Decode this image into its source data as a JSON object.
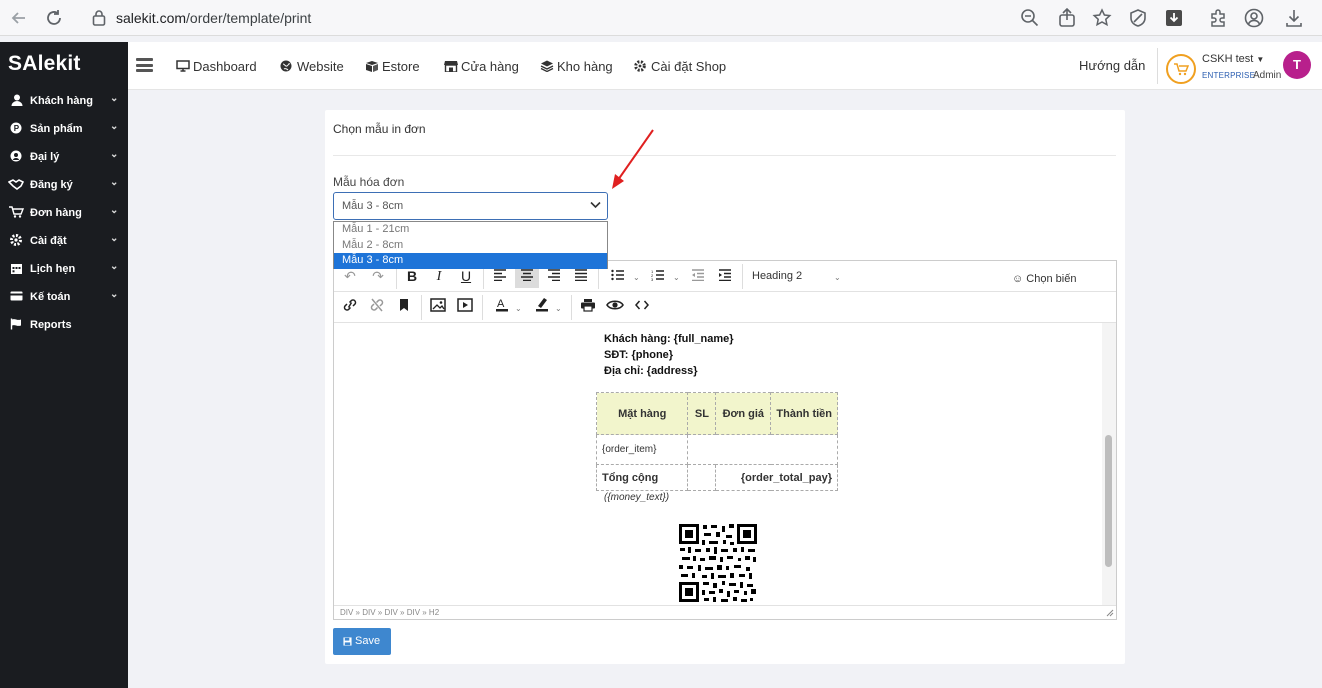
{
  "browser": {
    "url_host": "salekit.com",
    "url_path": "/order/template/print"
  },
  "app": {
    "logo": "SAlekit"
  },
  "sidebar": {
    "items": [
      {
        "label": "Khách hàng",
        "icon": "user-icon"
      },
      {
        "label": "Sản phẩm",
        "icon": "product-icon"
      },
      {
        "label": "Đại lý",
        "icon": "agent-icon"
      },
      {
        "label": "Đăng ký",
        "icon": "handshake-icon"
      },
      {
        "label": "Đơn hàng",
        "icon": "cart-icon"
      },
      {
        "label": "Cài đặt",
        "icon": "gear-icon"
      },
      {
        "label": "Lịch hẹn",
        "icon": "calendar-icon"
      },
      {
        "label": "Kế toán",
        "icon": "card-icon"
      },
      {
        "label": "Reports",
        "icon": "flag-icon"
      }
    ]
  },
  "topnav": {
    "items": [
      {
        "label": "Dashboard",
        "icon": "monitor-icon"
      },
      {
        "label": "Website",
        "icon": "globe-icon"
      },
      {
        "label": "Estore",
        "icon": "box-icon"
      },
      {
        "label": "Cửa hàng",
        "icon": "store-icon"
      },
      {
        "label": "Kho hàng",
        "icon": "layers-icon"
      },
      {
        "label": "Cài đặt Shop",
        "icon": "gear-icon"
      }
    ],
    "guide": "Hướng dẫn",
    "user_name": "CSKH test",
    "plan": "ENTERPRISE",
    "role": "Admin",
    "avatar_letter": "T"
  },
  "card": {
    "title": "Chọn mẫu in đơn",
    "field_label": "Mẫu hóa đơn",
    "selected": "Mẫu 3 - 8cm",
    "options": [
      "Mẫu 1 - 21cm",
      "Mẫu 2 - 8cm",
      "Mẫu 3 - 8cm"
    ]
  },
  "editor": {
    "heading_select": "Heading 2",
    "insert_variable": "Chọn biến",
    "status_path": "DIV » DIV » DIV » DIV » H2",
    "doc": {
      "customer": "Khách hàng: {full_name}",
      "phone": "SĐT: {phone}",
      "address": "Địa chỉ: {address}",
      "table_headers": [
        "Mặt hàng",
        "SL",
        "Đơn giá",
        "Thành tiền"
      ],
      "item_row": "{order_item}",
      "total_label": "Tổng cộng",
      "total_value": "{order_total_pay}",
      "money_text": "({money_text})"
    }
  },
  "actions": {
    "save": "Save"
  },
  "colors": {
    "sidebar_bg": "#1a1c20",
    "accent": "#3e87cf",
    "selected_option": "#1e74d8",
    "avatar": "#b8208c",
    "annotation_arrow": "#e02020"
  }
}
